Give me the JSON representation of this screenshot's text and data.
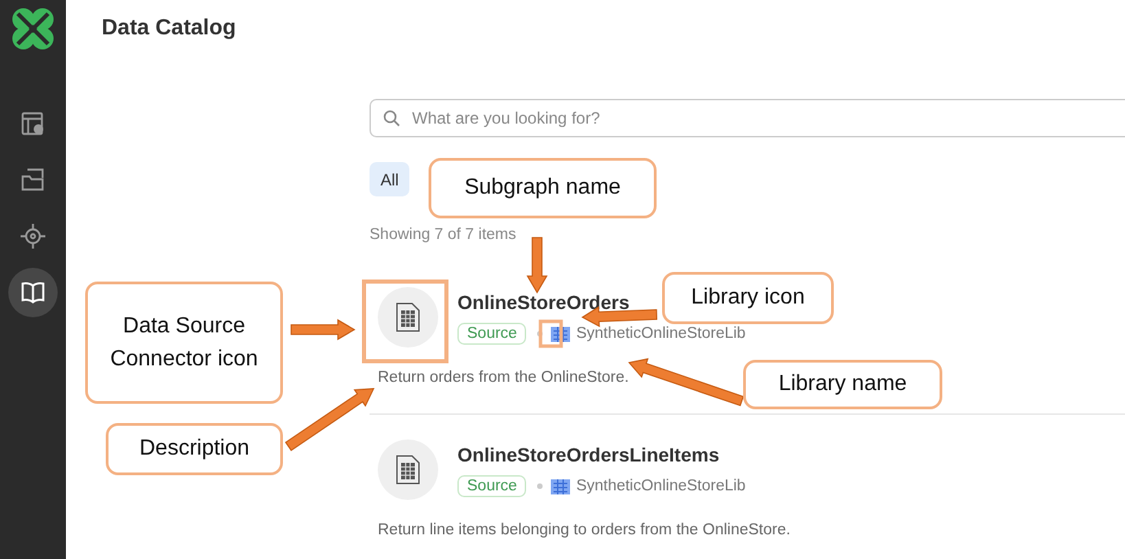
{
  "sidebar": {
    "items": [
      {
        "selected": false
      },
      {
        "selected": false
      },
      {
        "selected": false
      },
      {
        "selected": true
      }
    ]
  },
  "title": "Data Catalog",
  "search": {
    "placeholder": "What are you looking for?"
  },
  "filters": [
    {
      "label": "All",
      "selected": true
    }
  ],
  "result_count": "Showing 7 of 7 items",
  "items": [
    {
      "name": "OnlineStoreOrders",
      "badge": "Source",
      "library": "SyntheticOnlineStoreLib",
      "description": "Return orders from the OnlineStore."
    },
    {
      "name": "OnlineStoreOrdersLineItems",
      "badge": "Source",
      "library": "SyntheticOnlineStoreLib",
      "description": "Return line items belonging to orders from the OnlineStore."
    }
  ],
  "callouts": [
    {
      "text": "Subgraph name"
    },
    {
      "text": "Library icon"
    },
    {
      "text": "Data Source Connector icon"
    },
    {
      "text": "Library name"
    },
    {
      "text": "Description"
    }
  ]
}
